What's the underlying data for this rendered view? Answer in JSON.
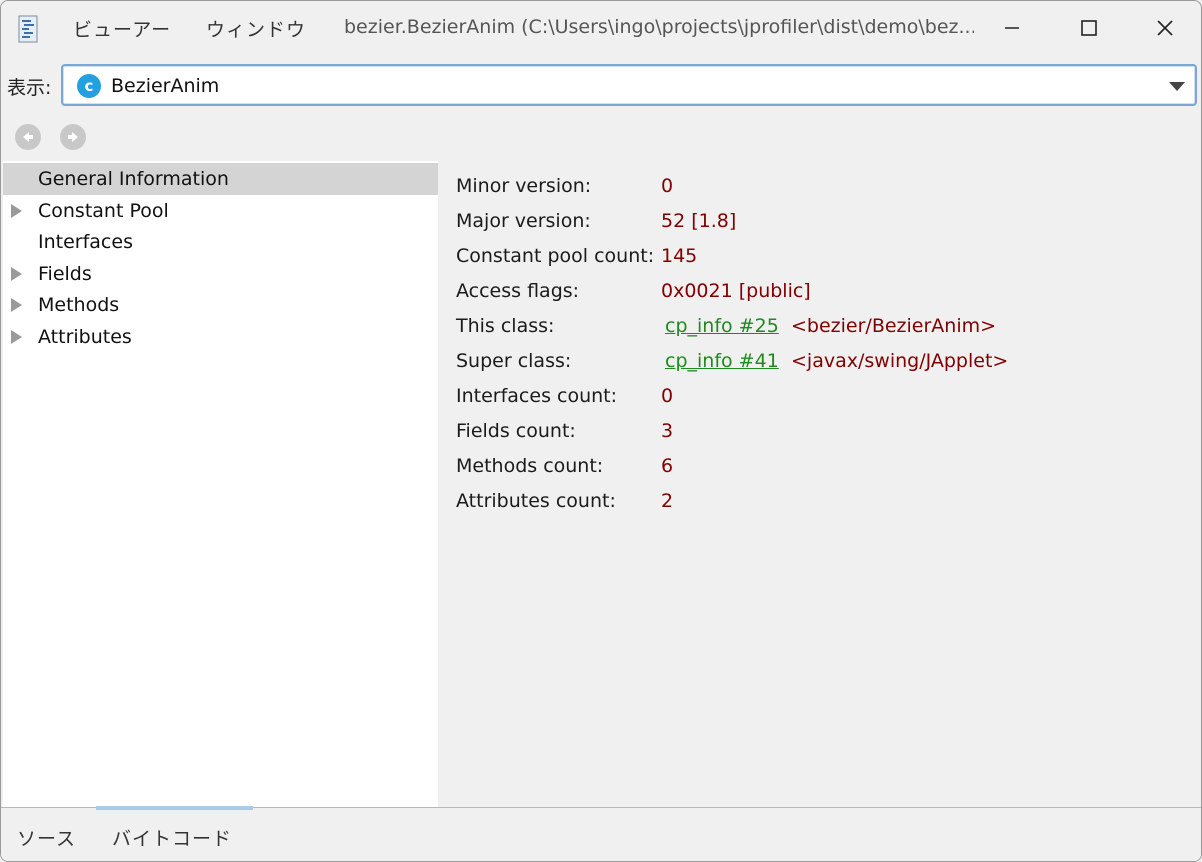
{
  "titlebar": {
    "menu_viewer": "ビューアー",
    "menu_window": "ウィンドウ",
    "title": "bezier.BezierAnim (C:\\Users\\ingo\\projects\\jprofiler\\dist\\demo\\bez..."
  },
  "viewbar": {
    "label": "表示:",
    "selected_class": "BezierAnim",
    "class_icon_letter": "c"
  },
  "tree": {
    "items": [
      {
        "label": "General Information",
        "expandable": false,
        "selected": true
      },
      {
        "label": "Constant Pool",
        "expandable": true,
        "selected": false
      },
      {
        "label": "Interfaces",
        "expandable": false,
        "selected": false
      },
      {
        "label": "Fields",
        "expandable": true,
        "selected": false
      },
      {
        "label": "Methods",
        "expandable": true,
        "selected": false
      },
      {
        "label": "Attributes",
        "expandable": true,
        "selected": false
      }
    ]
  },
  "info": {
    "minor_version": {
      "key": "Minor version:",
      "value": "0"
    },
    "major_version": {
      "key": "Major version:",
      "value": "52 [1.8]"
    },
    "constant_pool_count": {
      "key": "Constant pool count:",
      "value": "145"
    },
    "access_flags": {
      "key": "Access flags:",
      "value": "0x0021 [public]"
    },
    "this_class": {
      "key": "This class:",
      "link": "cp_info #25",
      "ref": "<bezier/BezierAnim>"
    },
    "super_class": {
      "key": "Super class:",
      "link": "cp_info #41",
      "ref": "<javax/swing/JApplet>"
    },
    "interfaces_count": {
      "key": "Interfaces count:",
      "value": "0"
    },
    "fields_count": {
      "key": "Fields count:",
      "value": "3"
    },
    "methods_count": {
      "key": "Methods count:",
      "value": "6"
    },
    "attributes_count": {
      "key": "Attributes count:",
      "value": "2"
    }
  },
  "tabs": {
    "source": "ソース",
    "bytecode": "バイトコード",
    "active": "bytecode"
  },
  "colors": {
    "value_text": "#800000",
    "link_text": "#1f8a1f",
    "class_icon": "#23a0e0",
    "selection": "#d4d4d4"
  }
}
